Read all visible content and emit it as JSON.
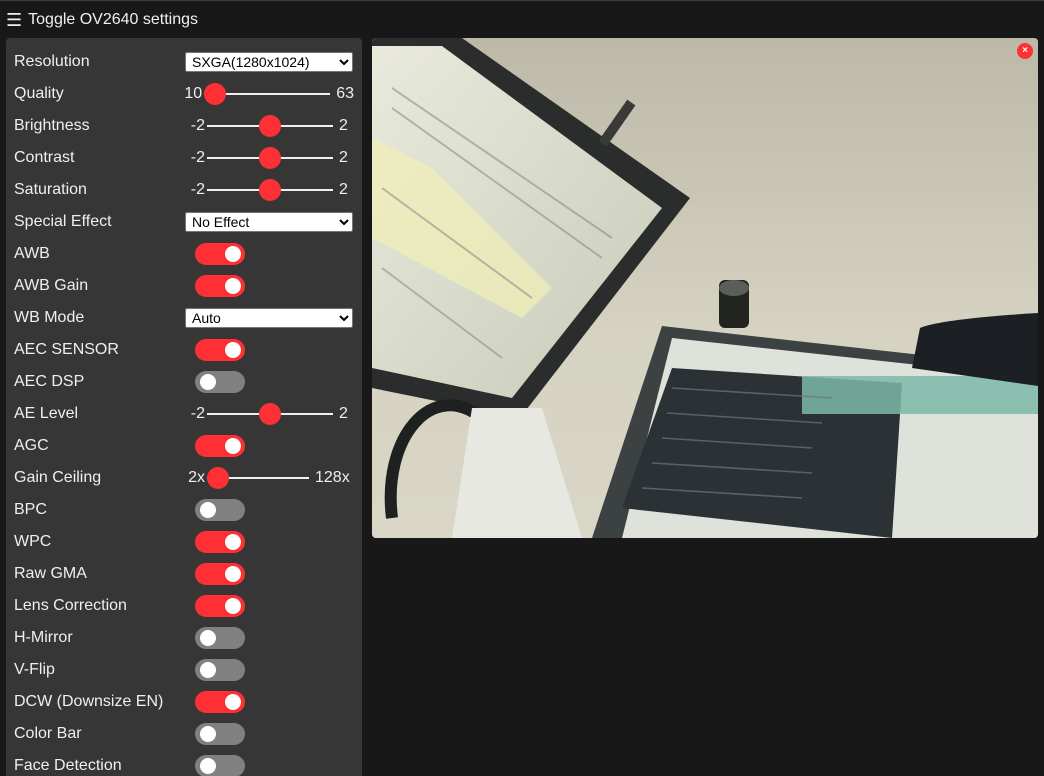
{
  "header": {
    "menu_icon": "☰",
    "title": "Toggle OV2640 settings"
  },
  "settings": {
    "resolution": {
      "label": "Resolution",
      "value": "SXGA(1280x1024)"
    },
    "quality": {
      "label": "Quality",
      "min": "10",
      "max": "63",
      "value": 10
    },
    "brightness": {
      "label": "Brightness",
      "min": "-2",
      "max": "2",
      "value": 0
    },
    "contrast": {
      "label": "Contrast",
      "min": "-2",
      "max": "2",
      "value": 0
    },
    "saturation": {
      "label": "Saturation",
      "min": "-2",
      "max": "2",
      "value": 0
    },
    "special_effect": {
      "label": "Special Effect",
      "value": "No Effect"
    },
    "awb": {
      "label": "AWB",
      "on": true
    },
    "awb_gain": {
      "label": "AWB Gain",
      "on": true
    },
    "wb_mode": {
      "label": "WB Mode",
      "value": "Auto"
    },
    "aec_sensor": {
      "label": "AEC SENSOR",
      "on": true
    },
    "aec_dsp": {
      "label": "AEC DSP",
      "on": false
    },
    "ae_level": {
      "label": "AE Level",
      "min": "-2",
      "max": "2",
      "value": 0
    },
    "agc": {
      "label": "AGC",
      "on": true
    },
    "gain_ceiling": {
      "label": "Gain Ceiling",
      "min": "2x",
      "max": "128x",
      "value": "2x"
    },
    "bpc": {
      "label": "BPC",
      "on": false
    },
    "wpc": {
      "label": "WPC",
      "on": true
    },
    "raw_gma": {
      "label": "Raw GMA",
      "on": true
    },
    "lens_correction": {
      "label": "Lens Correction",
      "on": true
    },
    "h_mirror": {
      "label": "H-Mirror",
      "on": false
    },
    "v_flip": {
      "label": "V-Flip",
      "on": false
    },
    "dcw": {
      "label": "DCW (Downsize EN)",
      "on": true
    },
    "color_bar": {
      "label": "Color Bar",
      "on": false
    },
    "face_detection": {
      "label": "Face Detection",
      "on": false
    }
  },
  "stream": {
    "close_icon": "×"
  },
  "colors": {
    "accent": "#ff3034",
    "panel": "#363636",
    "background": "#181818",
    "switch_off": "#808080"
  }
}
